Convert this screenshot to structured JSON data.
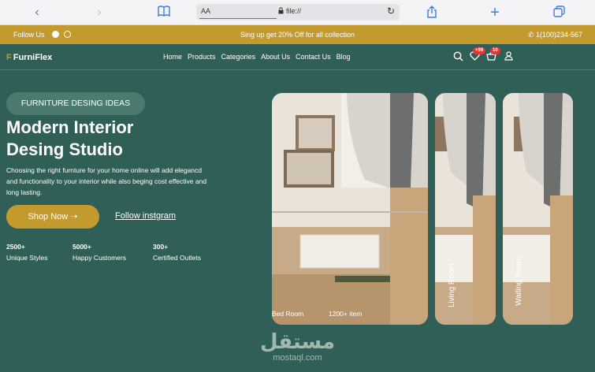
{
  "browser": {
    "text_size": "AA",
    "url": "file://"
  },
  "promo": {
    "follow": "Follow Us",
    "message": "Sing up get 20% Off for all collection",
    "phone": "1(100)234-567"
  },
  "nav": {
    "logo_letter": "F",
    "logo_name": "FurniFlex",
    "links": [
      "Home",
      "Products",
      "Categories",
      "About Us",
      "Contact Us",
      "Blog"
    ],
    "wishlist_badge": "+99",
    "cart_badge": "10"
  },
  "hero": {
    "tag": "FURNITURE DESING IDEAS",
    "title_line1": "Modern Interior",
    "title_line2": "Desing Studio",
    "description": "Choosing the right furnture for your home online will add elegancd and functionality to your interior while also beging cost effective and long lasting.",
    "shop_label": "Shop Now",
    "follow_label": "Follow instgram",
    "stats": [
      {
        "value": "2500+",
        "label": "Unique Styles"
      },
      {
        "value": "5000+",
        "label": "Happy Customers"
      },
      {
        "value": "300+",
        "label": "Certified Outlets"
      }
    ]
  },
  "cards": [
    {
      "name": "Bed Room",
      "count": "1200+ item"
    },
    {
      "name": "Living Room"
    },
    {
      "name": "Waiting Room"
    }
  ],
  "watermark": {
    "arabic": "مستقل",
    "latin": "mostaql.com"
  },
  "colors": {
    "primary": "#2f5f56",
    "accent": "#c39a2e"
  }
}
